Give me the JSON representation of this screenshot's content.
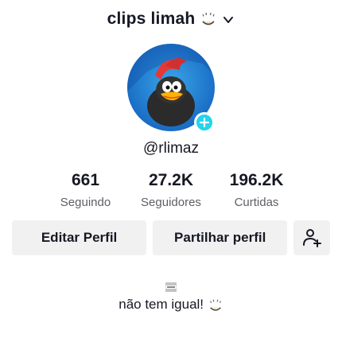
{
  "header": {
    "title": "clips limah",
    "title_emoji": "sparkle-face-emoji",
    "dropdown_icon": "chevron-down-icon"
  },
  "profile": {
    "username": "@rlimaz",
    "avatar_icon": "cartoon-bird-avatar",
    "add_story_icon": "plus-icon"
  },
  "stats": [
    {
      "value": "661",
      "label": "Seguindo"
    },
    {
      "value": "27.2K",
      "label": "Seguidores"
    },
    {
      "value": "196.2K",
      "label": "Curtidas"
    }
  ],
  "actions": {
    "edit_label": "Editar Perfil",
    "share_label": "Partilhar perfil",
    "add_friend_icon": "add-friend-icon"
  },
  "bio": {
    "flag_icon": "flag-icon",
    "text": "não tem igual!",
    "emoji": "sparkle-face-emoji"
  },
  "colors": {
    "accent": "#20d5ec",
    "button_bg": "#f1f1f2",
    "text": "#161823",
    "muted": "#5e5f66"
  }
}
